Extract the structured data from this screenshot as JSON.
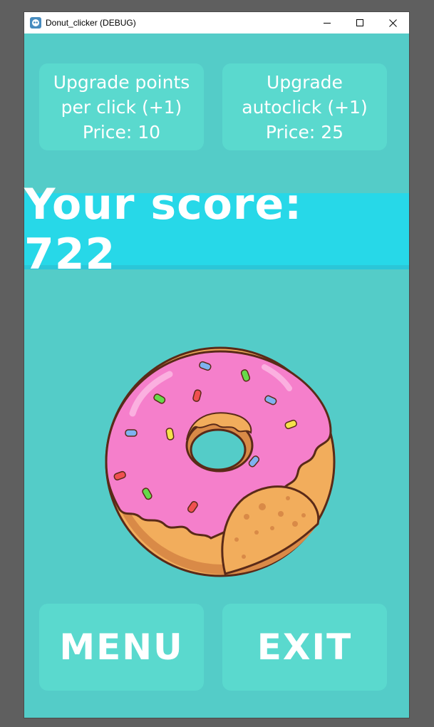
{
  "window": {
    "title": "Donut_clicker (DEBUG)",
    "icon": "godot-icon"
  },
  "controls": {
    "minimize": "—",
    "maximize": "☐",
    "close": "✕"
  },
  "upgrades": {
    "per_click": {
      "line1": "Upgrade points",
      "line2": "per click (+1)",
      "price": "Price: 10"
    },
    "autoclick": {
      "line1": "Upgrade",
      "line2": "autoclick (+1)",
      "price": "Price: 25"
    }
  },
  "score": {
    "text": "Your score: 722"
  },
  "buttons": {
    "menu": "MENU",
    "exit": "EXIT"
  },
  "colors": {
    "background": "#54ccc8",
    "button": "#5ad9ce",
    "score_bar": "#27d8e8",
    "frosting": "#f57fcb",
    "dough": "#f2ad5c"
  }
}
